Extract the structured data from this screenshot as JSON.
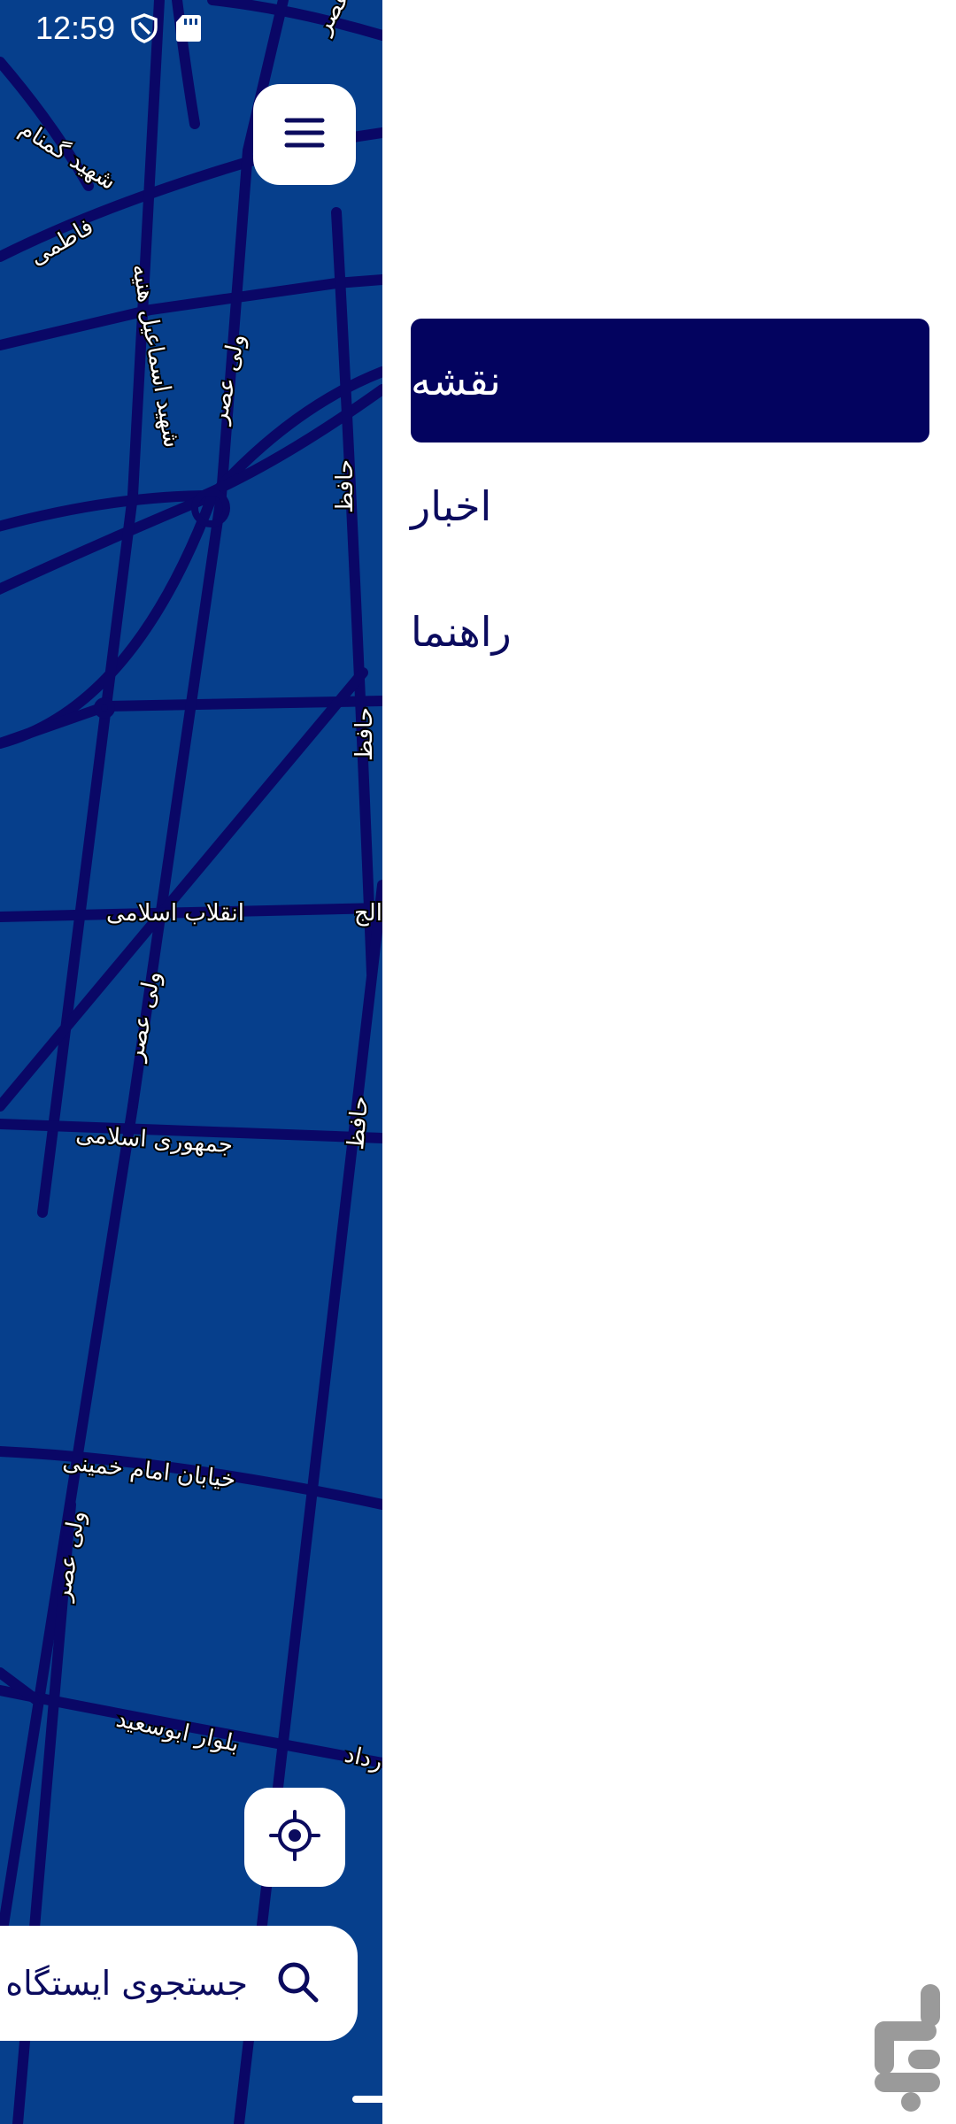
{
  "status_bar": {
    "time": "12:59",
    "icons": [
      "shield-icon",
      "sd-card-icon"
    ]
  },
  "map": {
    "background_color": "#063f8c",
    "road_color": "#0a0766",
    "street_labels": [
      "شهید گمنام",
      "فاطمی",
      "شهید اسماعیل هنیه",
      "ولی عصر",
      "حافظ",
      "انقلاب اسلامی",
      "ولی عصر",
      "جمهوری اسلامی",
      "خیابان امام خمینی",
      "ولی عصر",
      "بلوار ابوسعید",
      "ولی عصر",
      "حافظ",
      "الج",
      "حافظ",
      "رداد"
    ]
  },
  "menu_button": {
    "icon": "hamburger-icon"
  },
  "locate_button": {
    "icon": "crosshair-icon"
  },
  "search": {
    "placeholder": "جستجوی ایستگاه",
    "icon": "search-icon"
  },
  "drawer": {
    "items": [
      {
        "label": "نقشه",
        "active": true
      },
      {
        "label": "اخبار",
        "active": false
      },
      {
        "label": "راهنما",
        "active": false
      }
    ]
  },
  "watermark": {
    "icon": "bazaar-logo-icon"
  }
}
